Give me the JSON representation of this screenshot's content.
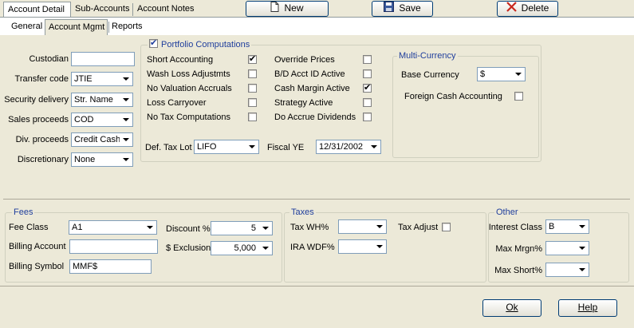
{
  "tabs_top": [
    "Account Detail",
    "Sub-Accounts",
    "Account Notes"
  ],
  "toolbar": {
    "new_label": "New",
    "save_label": "Save",
    "delete_label": "Delete"
  },
  "subtabs": [
    "General",
    "Account Mgmt",
    "Reports"
  ],
  "left": {
    "custodian_label": "Custodian",
    "custodian_value": "",
    "transfer_code_label": "Transfer code",
    "transfer_code_value": "JTIE",
    "security_delivery_label": "Security delivery",
    "security_delivery_value": "Str. Name",
    "sales_proceeds_label": "Sales proceeds",
    "sales_proceeds_value": "COD",
    "div_proceeds_label": "Div. proceeds",
    "div_proceeds_value": "Credit Cash",
    "discretionary_label": "Discretionary",
    "discretionary_value": "None"
  },
  "portfolio": {
    "title": "Portfolio Computations",
    "checked": true,
    "left_items": [
      {
        "label": "Short Accounting",
        "checked": true
      },
      {
        "label": "Wash Loss Adjustmts",
        "checked": false
      },
      {
        "label": "No Valuation  Accruals",
        "checked": false
      },
      {
        "label": "Loss Carryover",
        "checked": false
      },
      {
        "label": "No Tax Computations",
        "checked": false
      }
    ],
    "right_items": [
      {
        "label": "Override Prices",
        "checked": false
      },
      {
        "label": "B/D Acct ID Active",
        "checked": false
      },
      {
        "label": "Cash Margin Active",
        "checked": true
      },
      {
        "label": "Strategy Active",
        "checked": false
      },
      {
        "label": "Do Accrue Dividends",
        "checked": false
      }
    ],
    "def_tax_lot_label": "Def. Tax Lot",
    "def_tax_lot_value": "LIFO",
    "fiscal_ye_label": "Fiscal YE",
    "fiscal_ye_value": "12/31/2002"
  },
  "multi_currency": {
    "title": "Multi-Currency",
    "base_currency_label": "Base Currency",
    "base_currency_value": "$",
    "foreign_cash_label": "Foreign Cash Accounting",
    "foreign_cash_checked": false
  },
  "fees": {
    "title": "Fees",
    "fee_class_label": "Fee Class",
    "fee_class_value": "A1",
    "billing_account_label": "Billing Account",
    "billing_account_value": "",
    "billing_symbol_label": "Billing Symbol",
    "billing_symbol_value": "MMF$",
    "discount_label": "Discount %",
    "discount_value": "5",
    "exclusion_label": "$ Exclusion",
    "exclusion_value": "5,000"
  },
  "taxes": {
    "title": "Taxes",
    "tax_wh_label": "Tax WH%",
    "tax_wh_value": "",
    "ira_wdf_label": "IRA WDF%",
    "ira_wdf_value": "",
    "tax_adjust_label": "Tax Adjust",
    "tax_adjust_checked": false
  },
  "other": {
    "title": "Other",
    "interest_class_label": "Interest Class",
    "interest_class_value": "B",
    "max_mrgn_label": "Max Mrgn%",
    "max_mrgn_value": "",
    "max_short_label": "Max Short%",
    "max_short_value": ""
  },
  "footer": {
    "ok_label": "Ok",
    "help_label": "Help"
  }
}
